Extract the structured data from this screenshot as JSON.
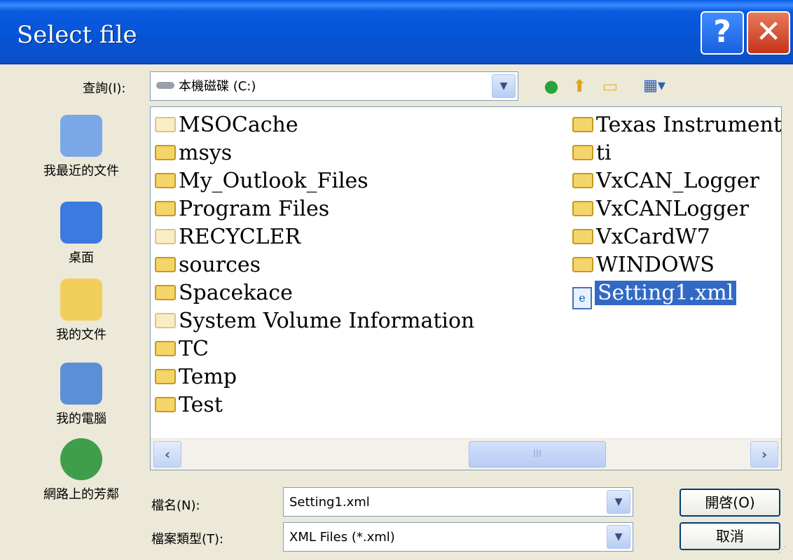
{
  "title": "Select file",
  "titlebar": {
    "help_glyph": "?",
    "close_glyph": "✕"
  },
  "look_in": {
    "label": "查詢(I):",
    "value": "本機磁碟 (C:)"
  },
  "toolbar": {
    "icons": [
      "back-icon",
      "up-folder-icon",
      "new-folder-icon",
      "view-menu-icon"
    ]
  },
  "places": [
    {
      "label": "我最近的文件",
      "icon": "recent-documents-icon",
      "color": "#7aa7e8"
    },
    {
      "label": "桌面",
      "icon": "desktop-icon",
      "color": "#3b7be0"
    },
    {
      "label": "我的文件",
      "icon": "my-documents-icon",
      "color": "#f2cf5c"
    },
    {
      "label": "我的電腦",
      "icon": "my-computer-icon",
      "color": "#5c8fd8"
    },
    {
      "label": "網路上的芳鄰",
      "icon": "network-places-icon",
      "color": "#3f9e4a"
    }
  ],
  "files": {
    "col1": [
      {
        "name": "MSOCache",
        "type": "folder",
        "hidden": true
      },
      {
        "name": "msys",
        "type": "folder"
      },
      {
        "name": "My_Outlook_Files",
        "type": "folder"
      },
      {
        "name": "Program Files",
        "type": "folder"
      },
      {
        "name": "RECYCLER",
        "type": "folder",
        "hidden": true
      },
      {
        "name": "sources",
        "type": "folder"
      },
      {
        "name": "Spacekace",
        "type": "folder"
      },
      {
        "name": "System Volume Information",
        "type": "folder",
        "hidden": true
      },
      {
        "name": "TC",
        "type": "folder"
      },
      {
        "name": "Temp",
        "type": "folder"
      },
      {
        "name": "Test",
        "type": "folder"
      }
    ],
    "col2": [
      {
        "name": "Texas Instruments",
        "type": "folder"
      },
      {
        "name": "ti",
        "type": "folder"
      },
      {
        "name": "VxCAN_Logger",
        "type": "folder"
      },
      {
        "name": "VxCANLogger",
        "type": "folder"
      },
      {
        "name": "VxCardW7",
        "type": "folder"
      },
      {
        "name": "WINDOWS",
        "type": "folder"
      },
      {
        "name": "Setting1.xml",
        "type": "xml",
        "selected": true
      }
    ]
  },
  "filename": {
    "label": "檔名(N):",
    "value": "Setting1.xml"
  },
  "filetype": {
    "label": "檔案類型(T):",
    "value": "XML Files (*.xml)"
  },
  "buttons": {
    "open": "開啓(O)",
    "cancel": "取消"
  },
  "scrollbar": {
    "thumb_glyph": "III",
    "left_glyph": "‹",
    "right_glyph": "›"
  }
}
